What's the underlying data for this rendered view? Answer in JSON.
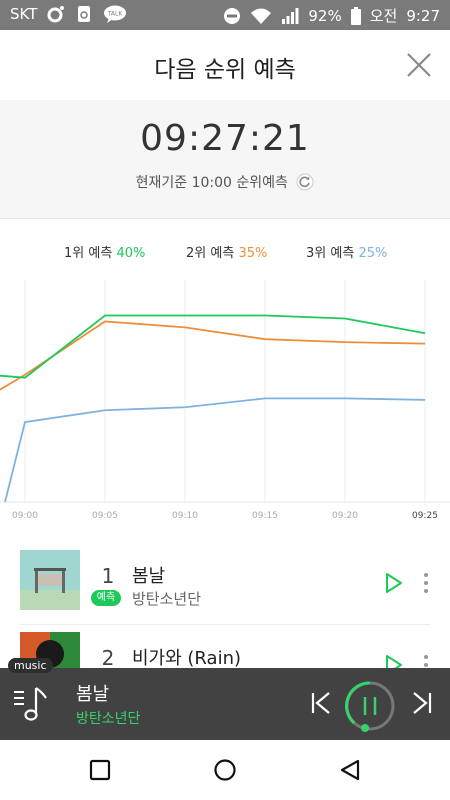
{
  "status_bar": {
    "carrier": "SKT",
    "battery": "92%",
    "ampm": "오전",
    "clock": "9:27",
    "icons": [
      "kakaotalk-icon",
      "recycle-icon",
      "talk-icon",
      "do-not-disturb-icon",
      "wifi-icon",
      "signal-icon",
      "battery-icon"
    ]
  },
  "header": {
    "title": "다음 순위 예측",
    "close_icon": "close-icon"
  },
  "time_panel": {
    "time": "09:27:21",
    "basis": "현재기준 10:00 순위예측",
    "refresh_icon": "refresh-icon"
  },
  "legend": [
    {
      "label": "1위 예측",
      "value": "40%",
      "color": "#1ec85a"
    },
    {
      "label": "2위 예측",
      "value": "35%",
      "color": "#ef8e3a"
    },
    {
      "label": "3위 예측",
      "value": "25%",
      "color": "#7fb2e0"
    }
  ],
  "chart_data": {
    "type": "line",
    "x": [
      "09:00",
      "09:05",
      "09:10",
      "09:15",
      "09:20",
      "09:25"
    ],
    "series": [
      {
        "color": "#1ec85a",
        "values": [
          4.2,
          6.3,
          6.3,
          6.3,
          6.2,
          5.7
        ]
      },
      {
        "color": "#ef8e3a",
        "values": [
          4.3,
          6.1,
          5.9,
          5.5,
          5.4,
          5.35
        ]
      },
      {
        "color": "#7fb2e0",
        "values": [
          2.7,
          3.1,
          3.2,
          3.5,
          3.5,
          3.45
        ]
      }
    ],
    "ylim": [
      0,
      7.5
    ],
    "grid": "vertical",
    "legend": "top"
  },
  "songs": [
    {
      "rank": "1",
      "title": "봄날",
      "artist": "방탄소년단",
      "badge": "예측"
    },
    {
      "rank": "2",
      "title": "비가와 (Rain)",
      "artist": ""
    }
  ],
  "player": {
    "tag": "music",
    "title": "봄날",
    "artist": "방탄소년단",
    "accent": "#35d46a"
  }
}
